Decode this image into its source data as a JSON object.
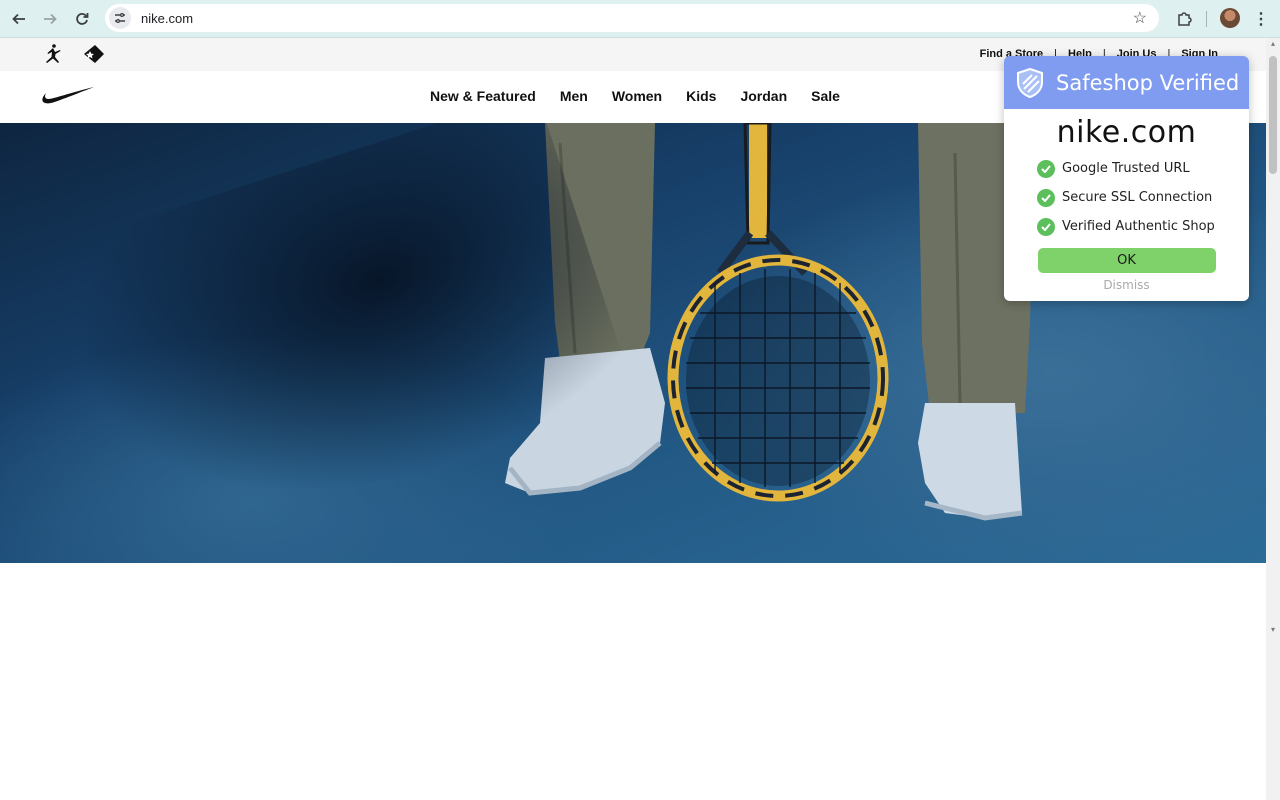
{
  "browser": {
    "url": "nike.com",
    "icons": {
      "back": "back-arrow-icon",
      "forward": "forward-arrow-icon",
      "reload": "reload-icon",
      "site_info": "tune-icon",
      "bookmark": "star-icon",
      "extensions": "puzzle-icon",
      "menu": "kebab-menu-icon"
    }
  },
  "utility_bar": {
    "links": [
      "Find a Store",
      "Help",
      "Join Us",
      "Sign In"
    ]
  },
  "main_nav": {
    "items": [
      "New & Featured",
      "Men",
      "Women",
      "Kids",
      "Jordan",
      "Sale"
    ]
  },
  "popup": {
    "title": "Safeshop Verified",
    "domain": "nike.com",
    "checks": [
      "Google Trusted URL",
      "Secure SSL Connection",
      "Verified Authentic Shop"
    ],
    "ok_label": "OK",
    "dismiss_label": "Dismiss",
    "colors": {
      "header": "#7f9cf0",
      "check": "#5cbf5c",
      "ok_button": "#7fd26a"
    }
  }
}
